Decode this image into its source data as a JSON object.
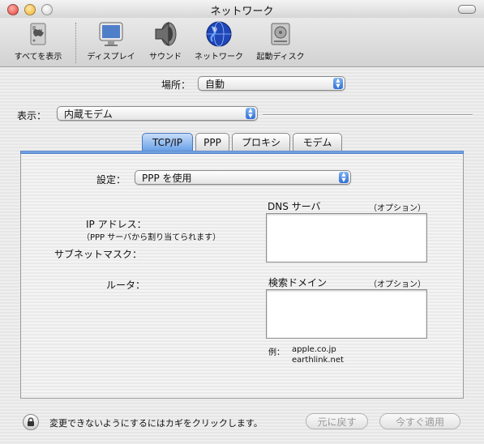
{
  "window": {
    "title": "ネットワーク"
  },
  "toolbar": {
    "items": [
      {
        "label": "すべてを表示",
        "icon": "apple-prefs-icon"
      },
      {
        "label": "ディスプレイ",
        "icon": "display-icon"
      },
      {
        "label": "サウンド",
        "icon": "speaker-icon"
      },
      {
        "label": "ネットワーク",
        "icon": "globe-icon"
      },
      {
        "label": "起動ディスク",
        "icon": "hard-disk-icon"
      }
    ]
  },
  "location": {
    "label": "場所：",
    "value": "自動"
  },
  "show": {
    "label": "表示：",
    "value": "内蔵モデム"
  },
  "tabs": [
    {
      "label": "TCP/IP",
      "active": true
    },
    {
      "label": "PPP",
      "active": false
    },
    {
      "label": "プロキシ",
      "active": false
    },
    {
      "label": "モデム",
      "active": false
    }
  ],
  "tcpip": {
    "config_label": "設定：",
    "config_value": "PPP を使用",
    "ip_label": "IP アドレス：",
    "ip_note": "（PPP サーバから割り当てられます）",
    "subnet_label": "サブネットマスク：",
    "router_label": "ルータ：",
    "dns_label": "DNS サーバ",
    "dns_optional": "（オプション）",
    "dns_value": "",
    "search_label": "検索ドメイン",
    "search_optional": "（オプション）",
    "search_value": "",
    "example_label": "例：",
    "example_1": "apple.co.jp",
    "example_2": "earthlink.net"
  },
  "footer": {
    "lock_text": "変更できないようにするにはカギをクリックします。",
    "revert_label": "元に戻す",
    "apply_label": "今すぐ適用"
  },
  "colors": {
    "close": "#e0413a",
    "minimize": "#f2b32a",
    "zoom_inactive": "#d8d8d8",
    "aqua_blue": "#2f6fd6"
  }
}
